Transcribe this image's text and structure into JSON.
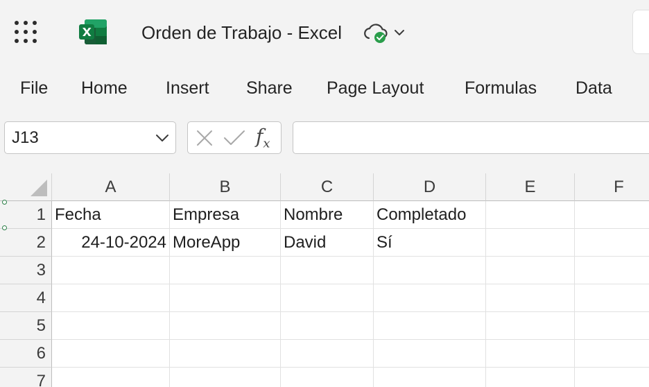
{
  "app": {
    "doc_title": "Orden de Trabajo - Excel",
    "icons": {
      "launcher": "app-launcher-icon",
      "logo": "excel-logo-icon",
      "cloud": "cloud-saved-icon",
      "chevron": "chevron-down-icon"
    },
    "colors": {
      "excel_green": "#107c41",
      "saved_green": "#2a9d4b"
    }
  },
  "menu": {
    "items": [
      {
        "label": "File"
      },
      {
        "label": "Home"
      },
      {
        "label": "Insert"
      },
      {
        "label": "Share"
      },
      {
        "label": "Page Layout"
      },
      {
        "label": "Formulas"
      },
      {
        "label": "Data"
      }
    ]
  },
  "formula_bar": {
    "name_box": "J13",
    "insert_function": "f",
    "insert_function_sub": "x",
    "formula": ""
  },
  "sheet": {
    "columns": [
      "A",
      "B",
      "C",
      "D",
      "E",
      "F"
    ],
    "rows": [
      "1",
      "2",
      "3",
      "4",
      "5",
      "6",
      "7"
    ],
    "cells": {
      "A1": "Fecha",
      "B1": "Empresa",
      "C1": "Nombre",
      "D1": "Completado",
      "A2": "24-10-2024",
      "B2": "MoreApp",
      "C2": "David",
      "D2": "Sí"
    }
  }
}
